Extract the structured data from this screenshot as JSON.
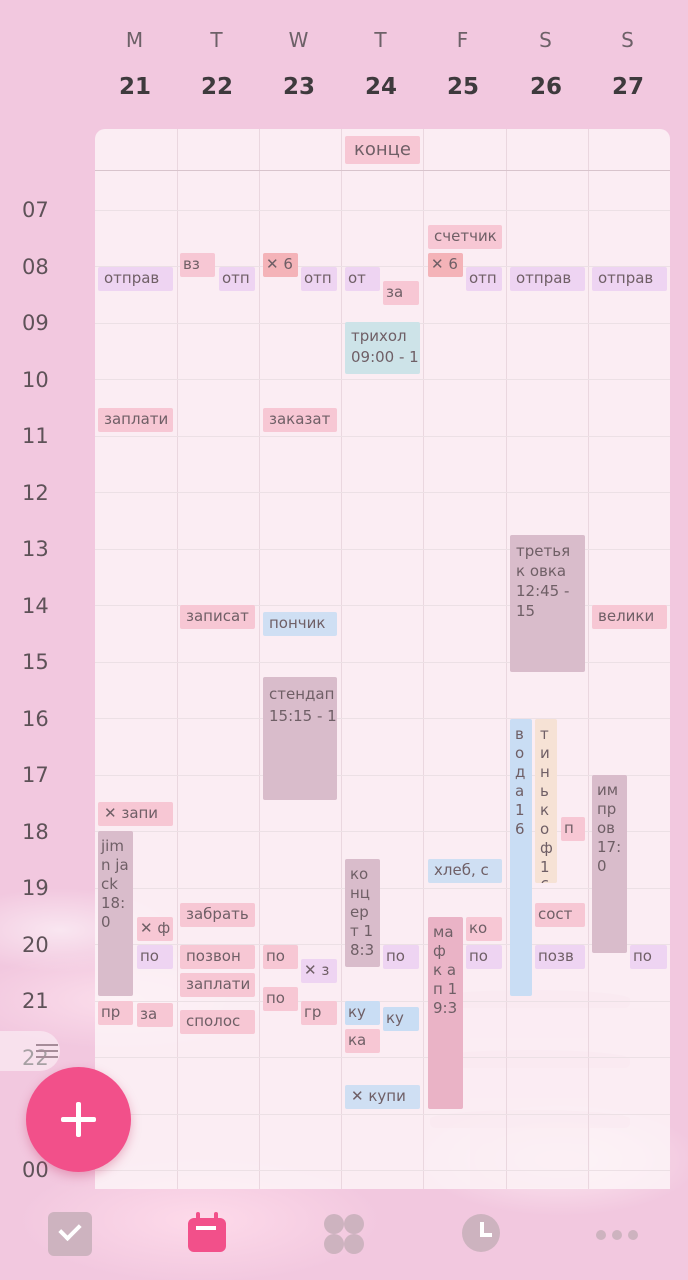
{
  "week": [
    {
      "letter": "M",
      "date": "21"
    },
    {
      "letter": "T",
      "date": "22"
    },
    {
      "letter": "W",
      "date": "23"
    },
    {
      "letter": "T",
      "date": "24"
    },
    {
      "letter": "F",
      "date": "25"
    },
    {
      "letter": "S",
      "date": "26"
    },
    {
      "letter": "S",
      "date": "27"
    }
  ],
  "hours": [
    "07",
    "08",
    "09",
    "10",
    "11",
    "12",
    "13",
    "14",
    "15",
    "16",
    "17",
    "18",
    "19",
    "20",
    "21",
    "22",
    "00"
  ],
  "allday": {
    "event": "конце"
  },
  "events": [
    {
      "text": "отправ"
    },
    {
      "text": "заплати"
    },
    {
      "text": "✕ запи"
    },
    {
      "text": "jim n jack 18:0"
    },
    {
      "text": "✕ ф"
    },
    {
      "text": "по"
    },
    {
      "text": "пр"
    },
    {
      "text": "за"
    },
    {
      "text": "вз"
    },
    {
      "text": "отп"
    },
    {
      "text": "записат"
    },
    {
      "text": "забрать"
    },
    {
      "text": "позвон"
    },
    {
      "text": "заплати"
    },
    {
      "text": "сполос"
    },
    {
      "text": "✕ 6"
    },
    {
      "text": "отп"
    },
    {
      "text": "заказат"
    },
    {
      "text": "пончик"
    },
    {
      "text": "стендап\n15:15 - 17"
    },
    {
      "text": "по"
    },
    {
      "text": "✕ з"
    },
    {
      "text": "по"
    },
    {
      "text": "гр"
    },
    {
      "text": "от"
    },
    {
      "text": "за"
    },
    {
      "text": "трихол\n09:00 - 1"
    },
    {
      "text": "конц ерт 18:3"
    },
    {
      "text": "по"
    },
    {
      "text": "ку"
    },
    {
      "text": "ку"
    },
    {
      "text": "ка"
    },
    {
      "text": "✕ купи"
    },
    {
      "text": "счетчик"
    },
    {
      "text": "✕ 6"
    },
    {
      "text": "отп"
    },
    {
      "text": "хлеб, с"
    },
    {
      "text": "ко"
    },
    {
      "text": "по"
    },
    {
      "text": "маф к ап 19:3"
    },
    {
      "text": "отправ"
    },
    {
      "text": "третьяк овка 12:45 - 15"
    },
    {
      "text": "вода 16"
    },
    {
      "text": "тинькоф 16"
    },
    {
      "text": "п"
    },
    {
      "text": "сост"
    },
    {
      "text": "позв"
    },
    {
      "text": "отправ"
    },
    {
      "text": "велики"
    },
    {
      "text": "импров 17:0"
    },
    {
      "text": "по"
    }
  ],
  "tabs": [
    "tasks",
    "calendar",
    "habits",
    "focus",
    "more"
  ],
  "colors": {
    "accent": "#f2508a",
    "background": "#f2c8df"
  }
}
